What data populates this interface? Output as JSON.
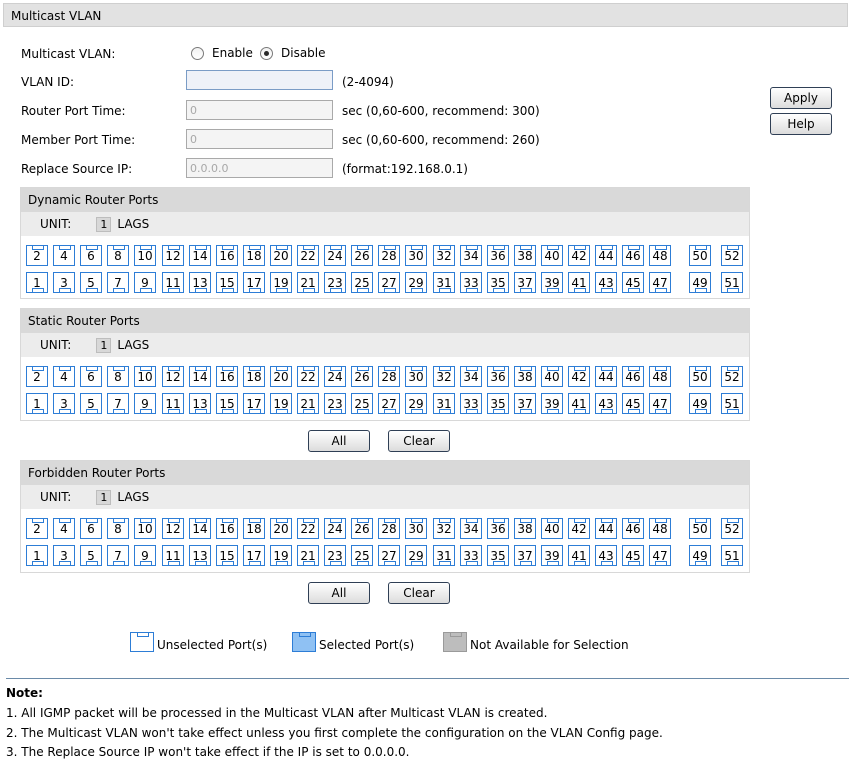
{
  "page": {
    "title": "Multicast VLAN"
  },
  "form": {
    "multicast_label": "Multicast VLAN:",
    "enable_label": "Enable",
    "disable_label": "Disable",
    "selected": "disable",
    "vlan_id_label": "VLAN ID:",
    "vlan_id_value": "",
    "vlan_id_hint": "(2-4094)",
    "router_time_label": "Router Port Time:",
    "router_time_value": "0",
    "router_time_hint": "sec (0,60-600, recommend: 300)",
    "member_time_label": "Member Port Time:",
    "member_time_value": "0",
    "member_time_hint": "sec (0,60-600, recommend: 260)",
    "replace_ip_label": "Replace Source IP:",
    "replace_ip_value": "0.0.0.0",
    "replace_ip_hint": "(format:192.168.0.1)"
  },
  "buttons": {
    "apply": "Apply",
    "help": "Help",
    "all": "All",
    "clear": "Clear"
  },
  "panels": {
    "dynamic": {
      "title": "Dynamic Router Ports"
    },
    "static": {
      "title": "Static Router Ports"
    },
    "forbidden": {
      "title": "Forbidden Router Ports"
    }
  },
  "unit": {
    "label": "UNIT:",
    "value": "1",
    "lags": "LAGS"
  },
  "ports": {
    "top": [
      "2",
      "4",
      "6",
      "8",
      "10",
      "12",
      "14",
      "16",
      "18",
      "20",
      "22",
      "24",
      "26",
      "28",
      "30",
      "32",
      "34",
      "36",
      "38",
      "40",
      "42",
      "44",
      "46",
      "48",
      "50",
      "52"
    ],
    "bottom": [
      "1",
      "3",
      "5",
      "7",
      "9",
      "11",
      "13",
      "15",
      "17",
      "19",
      "21",
      "23",
      "25",
      "27",
      "29",
      "31",
      "33",
      "35",
      "37",
      "39",
      "41",
      "43",
      "45",
      "47",
      "49",
      "51"
    ]
  },
  "legend": {
    "unselected": "Unselected Port(s)",
    "selected": "Selected Port(s)",
    "not_available": "Not Available for Selection"
  },
  "colors": {
    "port_border": "#2d7dd6",
    "selected_fill": "#8fc1f3",
    "unavailable_fill": "#bdbdbd"
  },
  "note": {
    "title": "Note:",
    "lines": [
      "1. All IGMP packet will be processed in the Multicast VLAN after Multicast VLAN is created.",
      "2. The Multicast VLAN won't take effect unless you first complete the configuration on the VLAN Config page.",
      "3. The Replace Source IP won't take effect if the IP is set to 0.0.0.0."
    ]
  }
}
